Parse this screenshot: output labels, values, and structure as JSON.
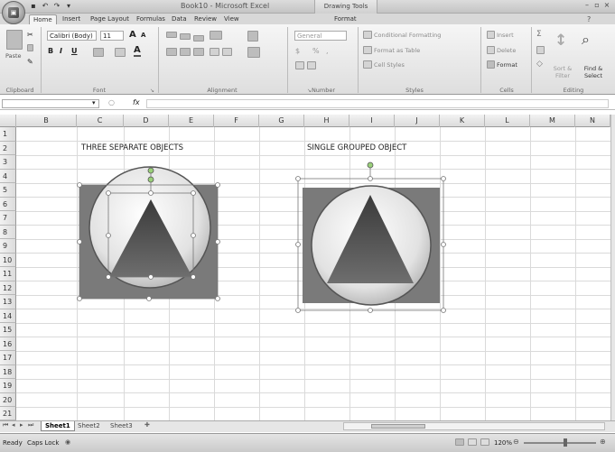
{
  "window": {
    "title": "Book10 - Microsoft Excel",
    "contextual_tab_group": "Drawing Tools"
  },
  "tabs": [
    "Home",
    "Insert",
    "Page Layout",
    "Formulas",
    "Data",
    "Review",
    "View",
    "Format"
  ],
  "active_tab": "Home",
  "ribbon": {
    "clipboard": {
      "label": "Clipboard",
      "paste": "Paste"
    },
    "font": {
      "label": "Font",
      "font_name": "Calibri (Body)",
      "font_size": "11",
      "grow": "A",
      "shrink": "A",
      "bold": "B",
      "italic": "I",
      "underline": "U"
    },
    "alignment": {
      "label": "Alignment"
    },
    "number": {
      "label": "Number",
      "format": "General",
      "currency": "$",
      "percent": "%",
      "comma": ","
    },
    "styles": {
      "label": "Styles",
      "conditional": "Conditional Formatting",
      "format_table": "Format as Table",
      "cell_styles": "Cell Styles"
    },
    "cells": {
      "label": "Cells",
      "insert": "Insert",
      "delete": "Delete",
      "format": "Format"
    },
    "editing": {
      "label": "Editing",
      "sum": "Σ",
      "sort": "Sort & Filter",
      "find": "Find & Select"
    }
  },
  "formula_bar": {
    "fx": "fx"
  },
  "columns": [
    "B",
    "C",
    "D",
    "E",
    "F",
    "G",
    "H",
    "I",
    "J",
    "K",
    "L",
    "M",
    "N"
  ],
  "rows": [
    "1",
    "2",
    "3",
    "4",
    "5",
    "6",
    "7",
    "8",
    "9",
    "10",
    "11",
    "12",
    "13",
    "14",
    "15",
    "16",
    "17",
    "18",
    "19",
    "20",
    "21"
  ],
  "cells": {
    "c2": "THREE SEPARATE OBJECTS",
    "h2": "SINGLE GROUPED OBJECT"
  },
  "sheets": [
    "Sheet1",
    "Sheet2",
    "Sheet3"
  ],
  "active_sheet": "Sheet1",
  "status": {
    "ready": "Ready",
    "caps_lock": "Caps Lock",
    "zoom": "120%"
  },
  "colors": {
    "rectangle": "#7a7a7a",
    "circle": "#dcdcdc",
    "triangle": "#555555"
  }
}
